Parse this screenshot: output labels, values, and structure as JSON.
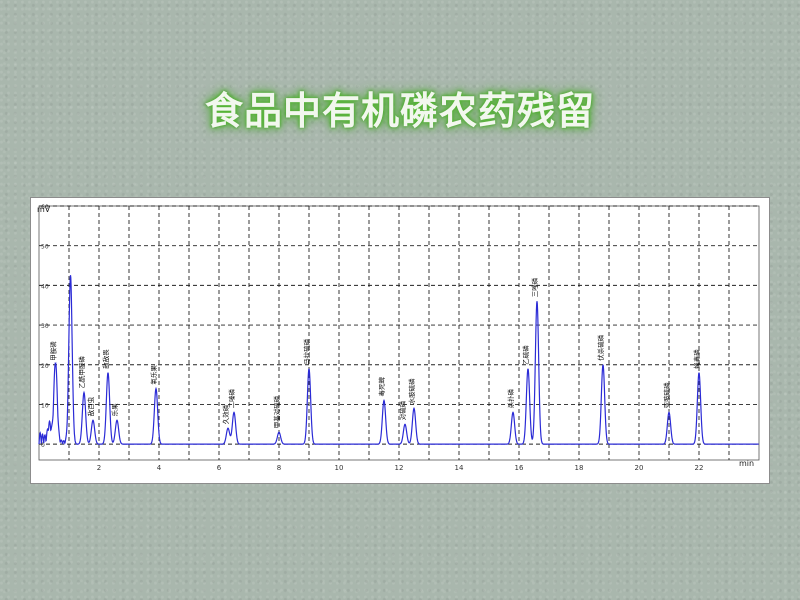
{
  "title": "食品中有机磷农药残留",
  "chart_data": {
    "type": "line",
    "ylabel": "mV",
    "xlabel": "min",
    "xlim": [
      0,
      24
    ],
    "ylim": [
      -4,
      60
    ],
    "x_ticks": [
      "1",
      "2",
      "3",
      "4",
      "5",
      "6",
      "7",
      "8",
      "9",
      "10",
      "11",
      "12",
      "13",
      "14",
      "15",
      "16",
      "17",
      "18",
      "19",
      "20",
      "21",
      "22",
      "23",
      "24"
    ],
    "y_ticks": [
      "0",
      "10",
      "20",
      "30",
      "40",
      "50",
      "60"
    ],
    "grid": true,
    "series": [
      {
        "color": "#2b2bd6",
        "peaks": [
          {
            "x": 0.35,
            "y": 4,
            "label": ""
          },
          {
            "x": 0.55,
            "y": 20,
            "label": "甲胺磷"
          },
          {
            "x": 1.05,
            "y": 42,
            "label": ""
          },
          {
            "x": 1.5,
            "y": 13,
            "label": "乙酰甲胺磷"
          },
          {
            "x": 1.8,
            "y": 6,
            "label": "敌百虫"
          },
          {
            "x": 2.3,
            "y": 18,
            "label": "敌敌畏"
          },
          {
            "x": 2.6,
            "y": 6,
            "label": "乐果"
          },
          {
            "x": 3.9,
            "y": 14,
            "label": "氧乐果"
          },
          {
            "x": 6.3,
            "y": 4,
            "label": "久效磷"
          },
          {
            "x": 6.5,
            "y": 8,
            "label": "二嗪磷"
          },
          {
            "x": 8.0,
            "y": 3,
            "label": "甲基对硫磷"
          },
          {
            "x": 9.0,
            "y": 19,
            "label": "马拉硫磷"
          },
          {
            "x": 11.5,
            "y": 11,
            "label": "毒死蜱"
          },
          {
            "x": 12.2,
            "y": 5,
            "label": "对硫磷"
          },
          {
            "x": 12.5,
            "y": 9,
            "label": "水胺硫磷"
          },
          {
            "x": 15.8,
            "y": 8,
            "label": "杀扑磷"
          },
          {
            "x": 16.3,
            "y": 19,
            "label": "乙硫磷"
          },
          {
            "x": 16.6,
            "y": 36,
            "label": "三唑磷"
          },
          {
            "x": 18.8,
            "y": 20,
            "label": "伏杀硫磷"
          },
          {
            "x": 21.0,
            "y": 8,
            "label": "亚胺硫磷"
          },
          {
            "x": 22.0,
            "y": 18,
            "label": "蝇毒磷"
          }
        ]
      }
    ]
  }
}
